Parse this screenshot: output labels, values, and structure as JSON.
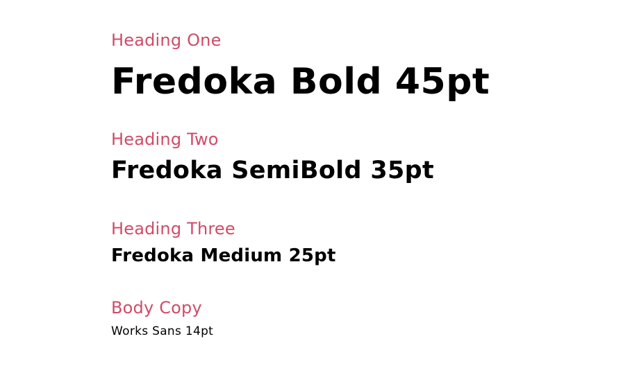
{
  "colors": {
    "label": "#d04b68",
    "sample": "#000000",
    "background": "#ffffff"
  },
  "type_scale": [
    {
      "label": "Heading One",
      "sample": "Fredoka Bold 45pt"
    },
    {
      "label": "Heading Two",
      "sample": "Fredoka SemiBold 35pt"
    },
    {
      "label": "Heading Three",
      "sample": "Fredoka Medium 25pt"
    },
    {
      "label": "Body Copy",
      "sample": "Works Sans 14pt"
    }
  ]
}
